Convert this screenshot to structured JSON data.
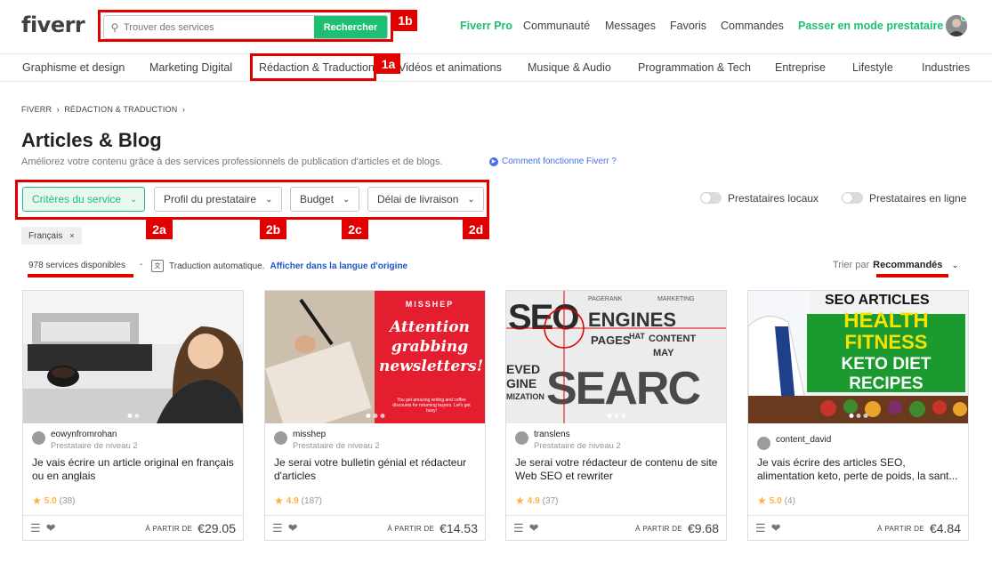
{
  "header": {
    "logo": "fiverr",
    "search_placeholder": "Trouver des services",
    "search_button": "Rechercher",
    "nav": [
      "Fiverr Pro",
      "Communauté",
      "Messages",
      "Favoris",
      "Commandes",
      "Passer en mode prestataire"
    ]
  },
  "categories": [
    "Graphisme et design",
    "Marketing Digital",
    "Rédaction & Traduction",
    "Vidéos et animations",
    "Musique & Audio",
    "Programmation & Tech",
    "Entreprise",
    "Lifestyle",
    "Industries"
  ],
  "annotations": {
    "a1a": "1a",
    "a1b": "1b",
    "a2a": "2a",
    "a2b": "2b",
    "a2c": "2c",
    "a2d": "2d"
  },
  "breadcrumb": {
    "home": "FIVERR",
    "section": "RÉDACTION & TRADUCTION"
  },
  "page": {
    "title": "Articles & Blog",
    "subtitle": "Améliorez votre contenu grâce à des services professionnels de publication d'articles et de blogs.",
    "how_link": "Comment fonctionne Fiverr ?"
  },
  "filters": [
    "Critères du service",
    "Profil du prestataire",
    "Budget",
    "Délai de livraison"
  ],
  "toggles": [
    "Prestataires locaux",
    "Prestataires en ligne"
  ],
  "chip": "Français",
  "results": {
    "count": "978 services disponibles",
    "sep": "-",
    "auto": "Traduction automatique.",
    "link": "Afficher dans la langue d'origine"
  },
  "sort": {
    "label": "Trier par",
    "value": "Recommandés"
  },
  "thumb_text": {
    "c2": {
      "brand": "MISSHEP",
      "headline": "Attention grabbing newsletters!",
      "small": "You get amazing writing and coffee discounts for returning buyers. Let's get busy!"
    },
    "c3": {
      "w1": "SEO",
      "w2": "ENGINES",
      "w3": "PAGES",
      "w4": "HAT",
      "w5": "CONTENT",
      "w6": "MAY",
      "w7": "SEARC",
      "w8": "EVED",
      "w9": "GINE",
      "w10": "MIZATION",
      "w11": "PAGERANK",
      "w12": "MARKETING"
    },
    "c4": {
      "l1": "SEO ARTICLES",
      "l2": "HEALTH",
      "l3": "FITNESS",
      "l4": "KETO DIET",
      "l5": "RECIPES"
    }
  },
  "cards": [
    {
      "seller": "eowynfromrohan",
      "level": "Prestataire de niveau 2",
      "title": "Je vais écrire un article original en français ou en anglais",
      "rating": "5.0",
      "count": "(38)",
      "from": "À PARTIR DE",
      "price": "€29.05"
    },
    {
      "seller": "misshep",
      "level": "Prestataire de niveau 2",
      "title": "Je serai votre bulletin génial et rédacteur d'articles",
      "rating": "4.9",
      "count": "(187)",
      "from": "À PARTIR DE",
      "price": "€14.53"
    },
    {
      "seller": "translens",
      "level": "Prestataire de niveau 2",
      "title": "Je serai votre rédacteur de contenu de site Web SEO et rewriter",
      "rating": "4.9",
      "count": "(37)",
      "from": "À PARTIR DE",
      "price": "€9.68"
    },
    {
      "seller": "content_david",
      "level": "",
      "title": "Je vais écrire des articles SEO, alimentation keto, perte de poids, la sant...",
      "rating": "5.0",
      "count": "(4)",
      "from": "À PARTIR DE",
      "price": "€4.84"
    }
  ],
  "colors": {
    "brand_green": "#1dbf73",
    "annotation_red": "#e10000",
    "star": "#ffb33e",
    "link_blue": "#446ee7"
  }
}
